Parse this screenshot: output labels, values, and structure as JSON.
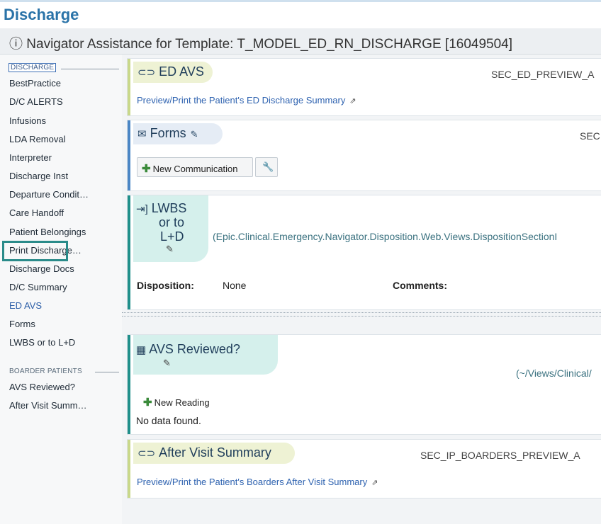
{
  "window": {
    "title": "Discharge"
  },
  "navigator": {
    "title": "ⓘ Navigator Assistance for Template: T_MODEL_ED_RN_DISCHARGE [16049504]"
  },
  "sidebar": {
    "section1": "DISCHARGE",
    "items": [
      "BestPractice",
      "D/C ALERTS",
      "Infusions",
      "LDA Removal",
      "Interpreter",
      "Discharge Inst",
      "Departure Condit…",
      "Care Handoff",
      "Patient Belongings",
      "Print Discharge…",
      "Discharge Docs",
      "D/C Summary",
      "ED AVS",
      "Forms",
      "LWBS or to L+D"
    ],
    "section2": "BOARDER PATIENTS",
    "items2": [
      "AVS Reviewed?",
      "After Visit Summ…"
    ],
    "selected": "ED AVS"
  },
  "sections": {
    "ed_avs": {
      "title": "ED AVS",
      "tag": "SEC_ED_PREVIEW_A",
      "link": "Preview/Print the Patient's ED Discharge Summary"
    },
    "forms": {
      "title": "Forms",
      "tag": "SEC",
      "button": "New Communication"
    },
    "lwbs": {
      "title_line1": "LWBS",
      "title_line2": "or to",
      "title_line3": "L+D",
      "path": "(Epic.Clinical.Emergency.Navigator.Disposition.Web.Views.DispositionSectionI",
      "disposition_label": "Disposition:",
      "disposition_value": "None",
      "comments_label": "Comments:"
    },
    "avs_reviewed": {
      "title": "AVS Reviewed?",
      "path": "(~/Views/Clinical/",
      "button": "New Reading",
      "empty": "No data found."
    },
    "after_visit": {
      "title": "After Visit Summary",
      "tag": "SEC_IP_BOARDERS_PREVIEW_A",
      "link": "Preview/Print the Patient's Boarders After Visit Summary"
    }
  },
  "colors": {
    "green_accent": "#c9d88a",
    "blue_accent": "#4a86c5",
    "teal_accent": "#1f8f8a",
    "teal_pill": "#d5f0ec",
    "green_pill": "#eef2d4",
    "blue_pill": "#e5ecf5",
    "selection_box": "#2a8b8a"
  }
}
